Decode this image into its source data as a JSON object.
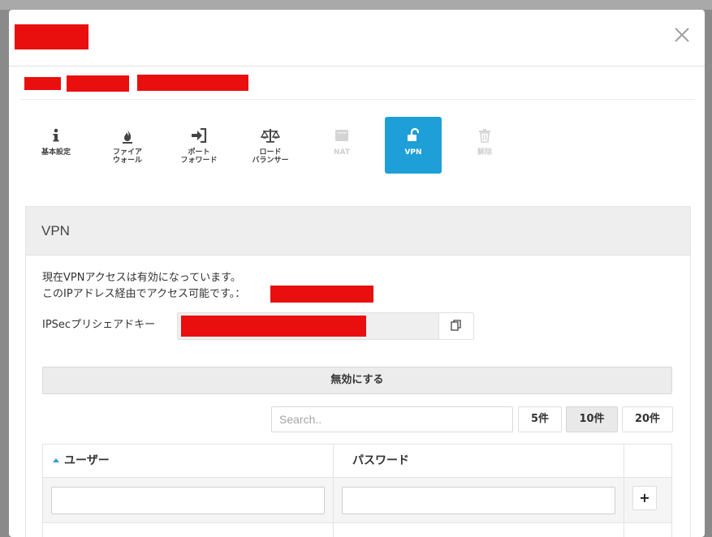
{
  "tabs": [
    {
      "label": "基本設定",
      "icon": "info-icon",
      "state": "normal"
    },
    {
      "label": "ファイア\nウォール",
      "icon": "fire-icon",
      "state": "normal"
    },
    {
      "label": "ポート\nフォワード",
      "icon": "sign-in-icon",
      "state": "normal"
    },
    {
      "label": "ロード\nバランサー",
      "icon": "balance-scale-icon",
      "state": "normal"
    },
    {
      "label": "NAT",
      "icon": "nat-icon",
      "state": "disabled"
    },
    {
      "label": "VPN",
      "icon": "unlock-icon",
      "state": "active"
    },
    {
      "label": "解除",
      "icon": "trash-icon",
      "state": "disabled"
    }
  ],
  "vpn": {
    "title": "VPN",
    "status_line1": "現在VPNアクセスは有効になっています。",
    "status_line2": "このIPアドレス経由でアクセス可能です。：",
    "psk_label": "IPSecプリシェアドキー",
    "disable_label": "無効にする"
  },
  "table_controls": {
    "search_placeholder": "Search..",
    "page_sizes": [
      {
        "label": "5件",
        "active": false
      },
      {
        "label": "10件",
        "active": true
      },
      {
        "label": "20件",
        "active": false
      }
    ]
  },
  "table": {
    "columns": [
      "ユーザー",
      "パスワード"
    ],
    "add_label": "+"
  },
  "colors": {
    "accent": "#1e9fd8",
    "redaction": "#e90f0f"
  }
}
